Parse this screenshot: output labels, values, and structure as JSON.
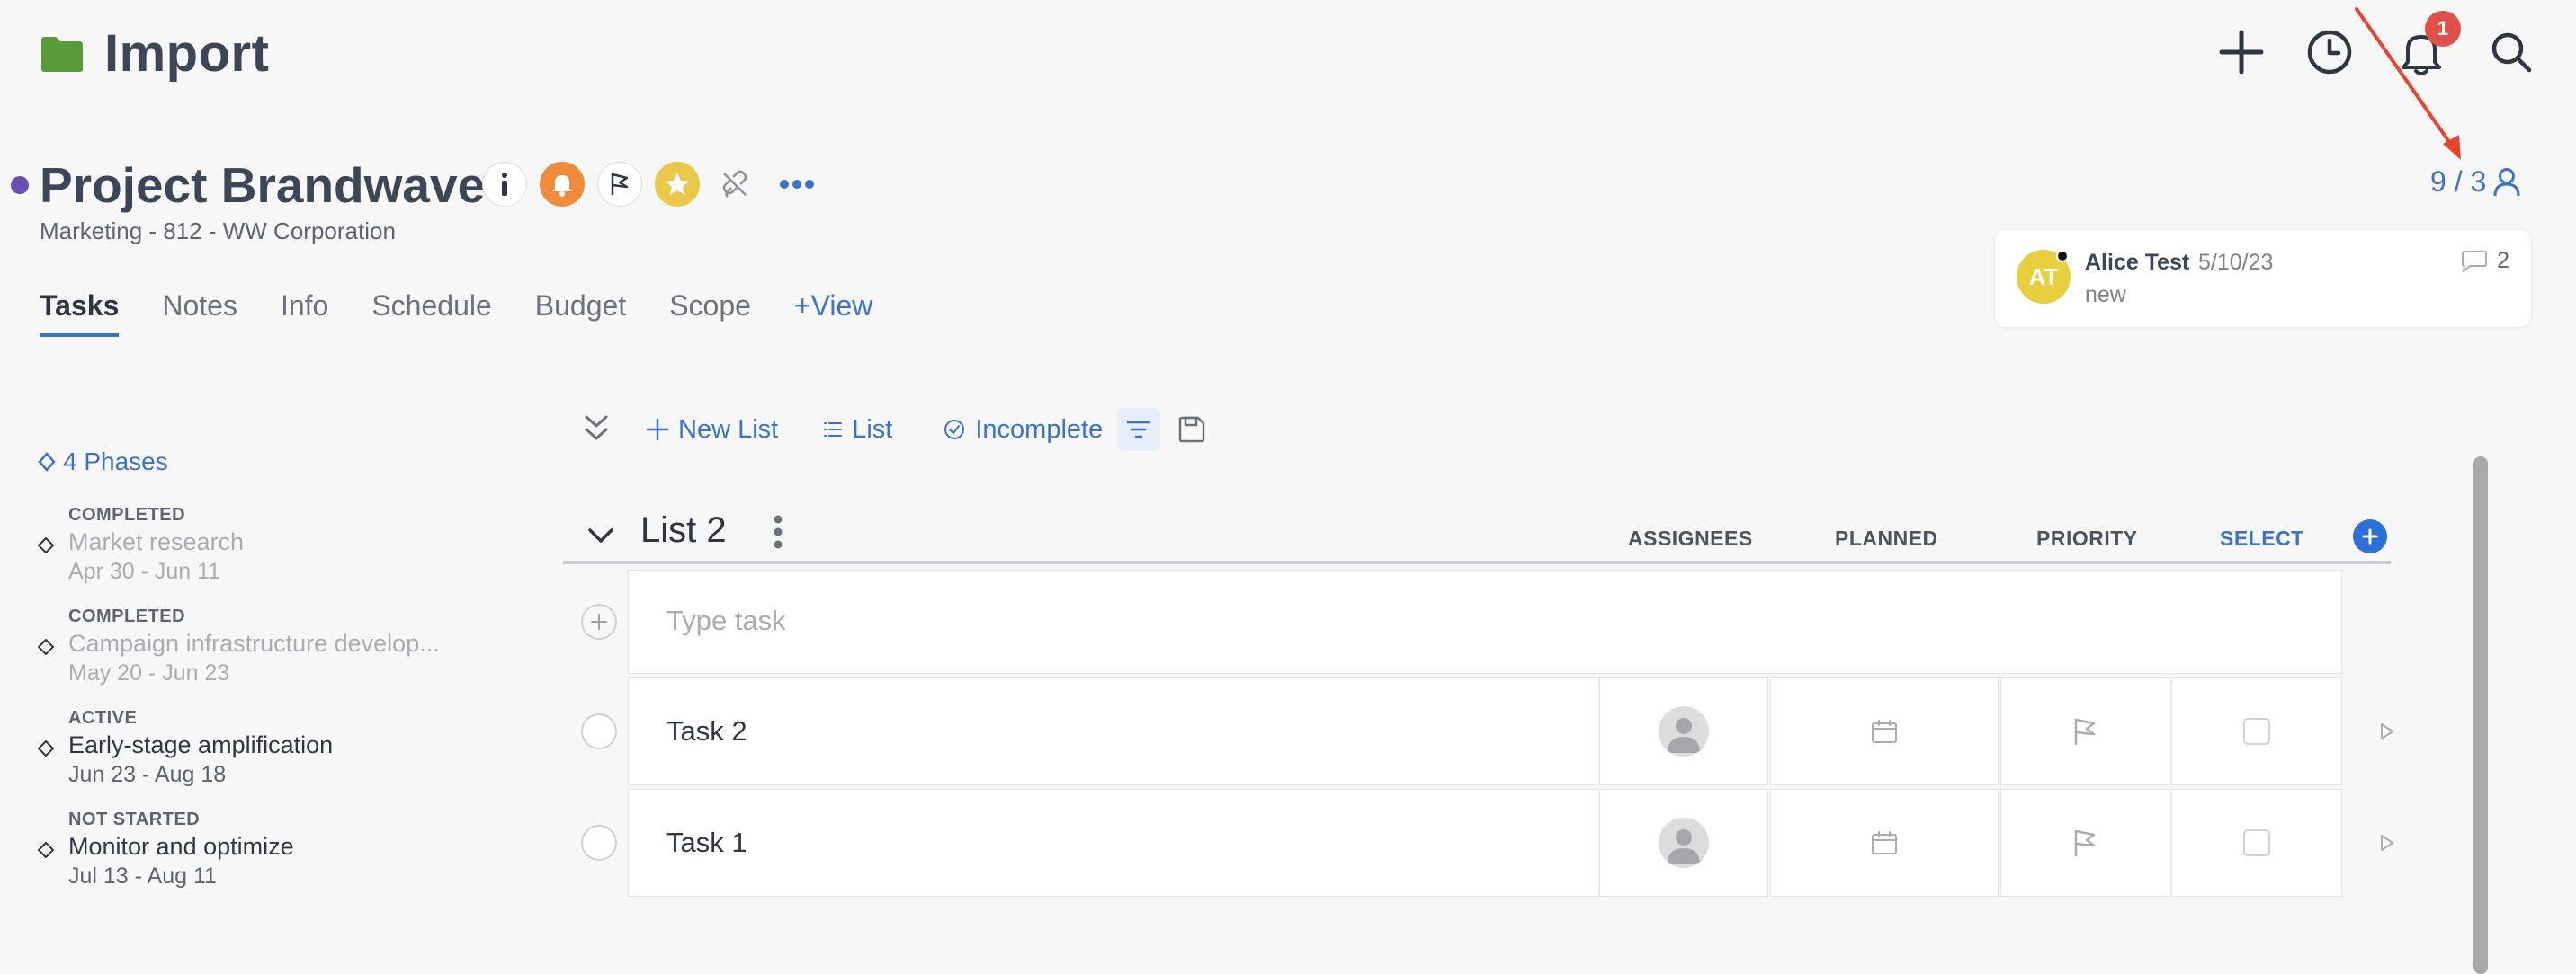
{
  "app": {
    "title": "Import",
    "notification_count": "1"
  },
  "project": {
    "title": "Project Brandwave",
    "subtitle": "Marketing - 812 - WW Corporation"
  },
  "tabs": [
    {
      "label": "Tasks",
      "active": true
    },
    {
      "label": "Notes"
    },
    {
      "label": "Info"
    },
    {
      "label": "Schedule"
    },
    {
      "label": "Budget"
    },
    {
      "label": "Scope"
    },
    {
      "label": "+View"
    }
  ],
  "members": {
    "count": "9 / 3"
  },
  "comment": {
    "initials": "AT",
    "author": "Alice Test",
    "date": "5/10/23",
    "text": "new",
    "count": "2"
  },
  "phases": {
    "header": "4 Phases",
    "items": [
      {
        "status": "COMPLETED",
        "name": "Market research",
        "dates": "Apr 30 - Jun 11"
      },
      {
        "status": "COMPLETED",
        "name": "Campaign infrastructure develop...",
        "dates": "May 20 - Jun 23"
      },
      {
        "status": "ACTIVE",
        "name": "Early-stage amplification",
        "dates": "Jun 23 - Aug 18"
      },
      {
        "status": "NOT STARTED",
        "name": "Monitor and optimize",
        "dates": "Jul 13 - Aug 11"
      }
    ]
  },
  "toolbar": {
    "new_list": "New List",
    "list": "List",
    "incomplete": "Incomplete"
  },
  "list": {
    "name": "List 2",
    "columns": {
      "assignees": "ASSIGNEES",
      "planned": "PLANNED",
      "priority": "PRIORITY",
      "select": "SELECT"
    },
    "placeholder": "Type task",
    "tasks": [
      {
        "name": "Task 2"
      },
      {
        "name": "Task 1"
      }
    ]
  },
  "colors": {
    "accent": "#3a73c9",
    "project_dot": "#6b4fb0",
    "badge": "#e0504b",
    "folder": "#5a9a3a",
    "annotation_arrow": "#e8452c"
  }
}
